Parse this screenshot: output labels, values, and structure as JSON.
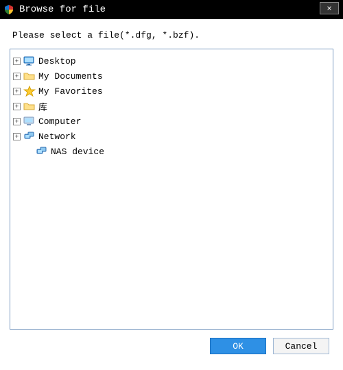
{
  "titlebar": {
    "title": "Browse for file",
    "close_label": "×"
  },
  "instruction": "Please select a file(*.dfg, *.bzf).",
  "tree": {
    "items": [
      {
        "icon": "monitor",
        "label": "Desktop",
        "expandable": true,
        "indent": 0
      },
      {
        "icon": "folder",
        "label": "My Documents",
        "expandable": true,
        "indent": 0
      },
      {
        "icon": "star",
        "label": "My Favorites",
        "expandable": true,
        "indent": 0
      },
      {
        "icon": "folder",
        "label": "库",
        "expandable": true,
        "indent": 0
      },
      {
        "icon": "computer",
        "label": "Computer",
        "expandable": true,
        "indent": 0
      },
      {
        "icon": "network",
        "label": "Network",
        "expandable": true,
        "indent": 0
      },
      {
        "icon": "network",
        "label": "NAS device",
        "expandable": false,
        "indent": 1
      }
    ]
  },
  "buttons": {
    "ok": "OK",
    "cancel": "Cancel"
  },
  "icons": {
    "app": "shield-icon",
    "close": "close-icon"
  }
}
